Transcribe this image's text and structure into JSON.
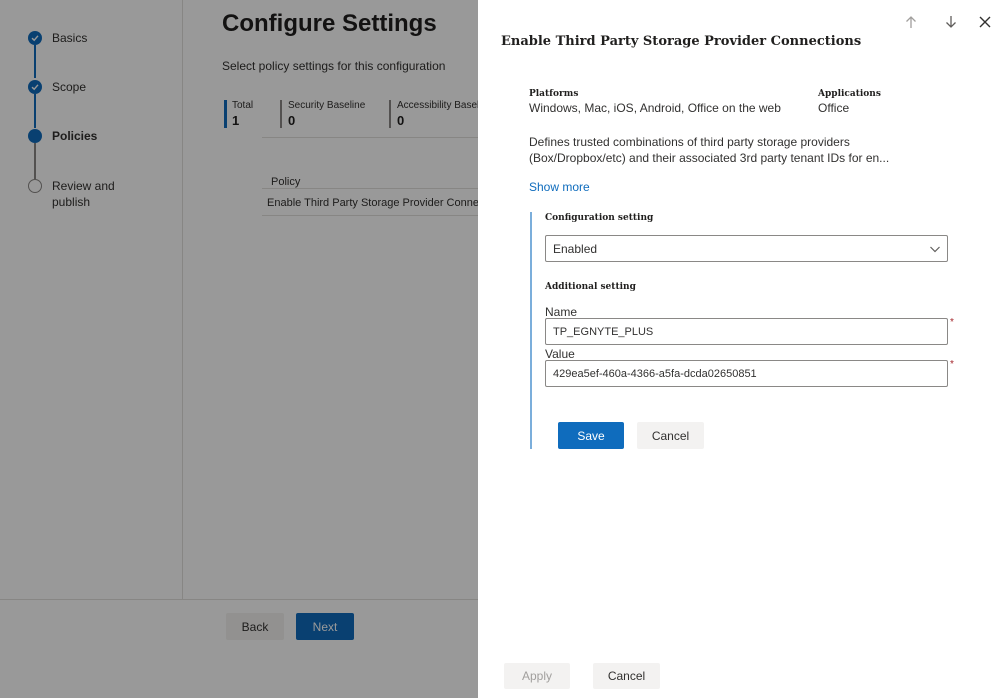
{
  "wizard": {
    "steps": [
      {
        "label": "Basics",
        "state": "done"
      },
      {
        "label": "Scope",
        "state": "done"
      },
      {
        "label": "Policies",
        "state": "current"
      },
      {
        "label_line1": "Review and",
        "label_line2": "publish",
        "state": "pending"
      }
    ],
    "title": "Configure Settings",
    "subtitle": "Select policy settings for this configuration",
    "stats": [
      {
        "label": "Total",
        "value": "1"
      },
      {
        "label": "Security Baseline",
        "value": "0"
      },
      {
        "label": "Accessibility Baseli",
        "value": "0"
      }
    ],
    "policy_column_header": "Policy",
    "policy_row": "Enable Third Party Storage Provider Connect",
    "back_label": "Back",
    "next_label": "Next"
  },
  "panel": {
    "title": "Enable Third Party Storage Provider Connections",
    "icons": [
      "arrow-up-icon",
      "arrow-down-icon",
      "close-icon"
    ],
    "platforms_label": "Platforms",
    "platforms_value": "Windows, Mac, iOS, Android, Office on the web",
    "applications_label": "Applications",
    "applications_value": "Office",
    "description": "Defines trusted combinations of third party storage providers (Box/Dropbox/etc) and their associated 3rd party tenant IDs for en...",
    "show_more": "Show more",
    "configuration_setting_label": "Configuration setting",
    "configuration_setting_value": "Enabled",
    "additional_setting_label": "Additional setting",
    "name_label": "Name",
    "name_value": "TP_EGNYTE_PLUS",
    "value_label": "Value",
    "value_value": "429ea5ef-460a-4366-a5fa-dcda02650851",
    "required_marker": "*",
    "save_label": "Save",
    "cancel_label": "Cancel",
    "apply_label": "Apply",
    "footer_cancel_label": "Cancel"
  },
  "colors": {
    "accent": "#0f6cbd",
    "overlay": "rgba(0,0,0,0.4)",
    "required": "#a4262c"
  }
}
